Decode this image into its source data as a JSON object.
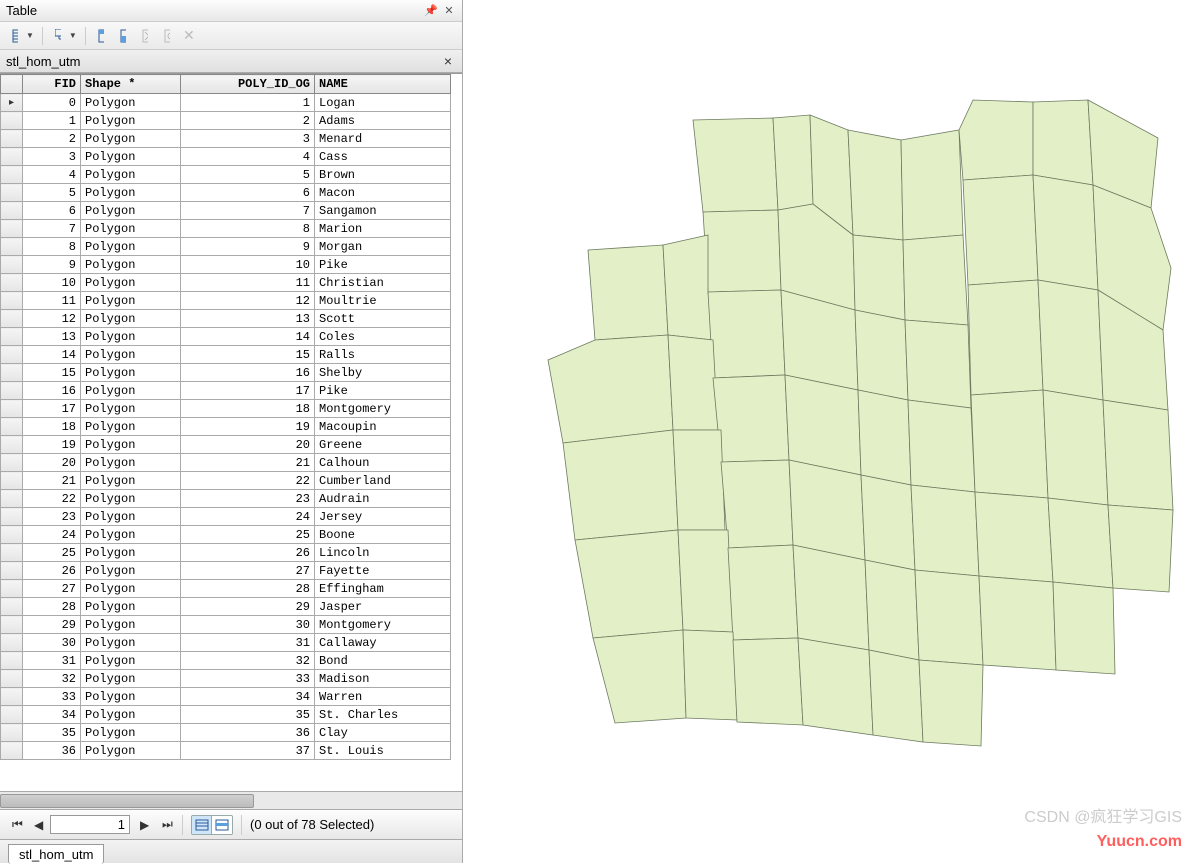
{
  "panel": {
    "title": "Table"
  },
  "tab": {
    "name": "stl_hom_utm"
  },
  "columns": [
    "FID",
    "Shape *",
    "POLY_ID_OG",
    "NAME"
  ],
  "rows": [
    {
      "fid": 0,
      "shape": "Polygon",
      "poly": 1,
      "name": "Logan",
      "cursor": true
    },
    {
      "fid": 1,
      "shape": "Polygon",
      "poly": 2,
      "name": "Adams"
    },
    {
      "fid": 2,
      "shape": "Polygon",
      "poly": 3,
      "name": "Menard"
    },
    {
      "fid": 3,
      "shape": "Polygon",
      "poly": 4,
      "name": "Cass"
    },
    {
      "fid": 4,
      "shape": "Polygon",
      "poly": 5,
      "name": "Brown"
    },
    {
      "fid": 5,
      "shape": "Polygon",
      "poly": 6,
      "name": "Macon"
    },
    {
      "fid": 6,
      "shape": "Polygon",
      "poly": 7,
      "name": "Sangamon"
    },
    {
      "fid": 7,
      "shape": "Polygon",
      "poly": 8,
      "name": "Marion"
    },
    {
      "fid": 8,
      "shape": "Polygon",
      "poly": 9,
      "name": "Morgan"
    },
    {
      "fid": 9,
      "shape": "Polygon",
      "poly": 10,
      "name": "Pike"
    },
    {
      "fid": 10,
      "shape": "Polygon",
      "poly": 11,
      "name": "Christian"
    },
    {
      "fid": 11,
      "shape": "Polygon",
      "poly": 12,
      "name": "Moultrie"
    },
    {
      "fid": 12,
      "shape": "Polygon",
      "poly": 13,
      "name": "Scott"
    },
    {
      "fid": 13,
      "shape": "Polygon",
      "poly": 14,
      "name": "Coles"
    },
    {
      "fid": 14,
      "shape": "Polygon",
      "poly": 15,
      "name": "Ralls"
    },
    {
      "fid": 15,
      "shape": "Polygon",
      "poly": 16,
      "name": "Shelby"
    },
    {
      "fid": 16,
      "shape": "Polygon",
      "poly": 17,
      "name": "Pike"
    },
    {
      "fid": 17,
      "shape": "Polygon",
      "poly": 18,
      "name": "Montgomery"
    },
    {
      "fid": 18,
      "shape": "Polygon",
      "poly": 19,
      "name": "Macoupin"
    },
    {
      "fid": 19,
      "shape": "Polygon",
      "poly": 20,
      "name": "Greene"
    },
    {
      "fid": 20,
      "shape": "Polygon",
      "poly": 21,
      "name": "Calhoun"
    },
    {
      "fid": 21,
      "shape": "Polygon",
      "poly": 22,
      "name": "Cumberland"
    },
    {
      "fid": 22,
      "shape": "Polygon",
      "poly": 23,
      "name": "Audrain"
    },
    {
      "fid": 23,
      "shape": "Polygon",
      "poly": 24,
      "name": "Jersey"
    },
    {
      "fid": 24,
      "shape": "Polygon",
      "poly": 25,
      "name": "Boone"
    },
    {
      "fid": 25,
      "shape": "Polygon",
      "poly": 26,
      "name": "Lincoln"
    },
    {
      "fid": 26,
      "shape": "Polygon",
      "poly": 27,
      "name": "Fayette"
    },
    {
      "fid": 27,
      "shape": "Polygon",
      "poly": 28,
      "name": "Effingham"
    },
    {
      "fid": 28,
      "shape": "Polygon",
      "poly": 29,
      "name": "Jasper"
    },
    {
      "fid": 29,
      "shape": "Polygon",
      "poly": 30,
      "name": "Montgomery"
    },
    {
      "fid": 30,
      "shape": "Polygon",
      "poly": 31,
      "name": "Callaway"
    },
    {
      "fid": 31,
      "shape": "Polygon",
      "poly": 32,
      "name": "Bond"
    },
    {
      "fid": 32,
      "shape": "Polygon",
      "poly": 33,
      "name": "Madison"
    },
    {
      "fid": 33,
      "shape": "Polygon",
      "poly": 34,
      "name": "Warren"
    },
    {
      "fid": 34,
      "shape": "Polygon",
      "poly": 35,
      "name": "St. Charles"
    },
    {
      "fid": 35,
      "shape": "Polygon",
      "poly": 36,
      "name": "Clay"
    },
    {
      "fid": 36,
      "shape": "Polygon",
      "poly": 37,
      "name": "St. Louis"
    }
  ],
  "nav": {
    "current": "1",
    "status": "(0 out of 78 Selected)"
  },
  "watermarks": {
    "csdn": "CSDN @疯狂学习GIS",
    "yuucn": "Yuucn.com"
  }
}
